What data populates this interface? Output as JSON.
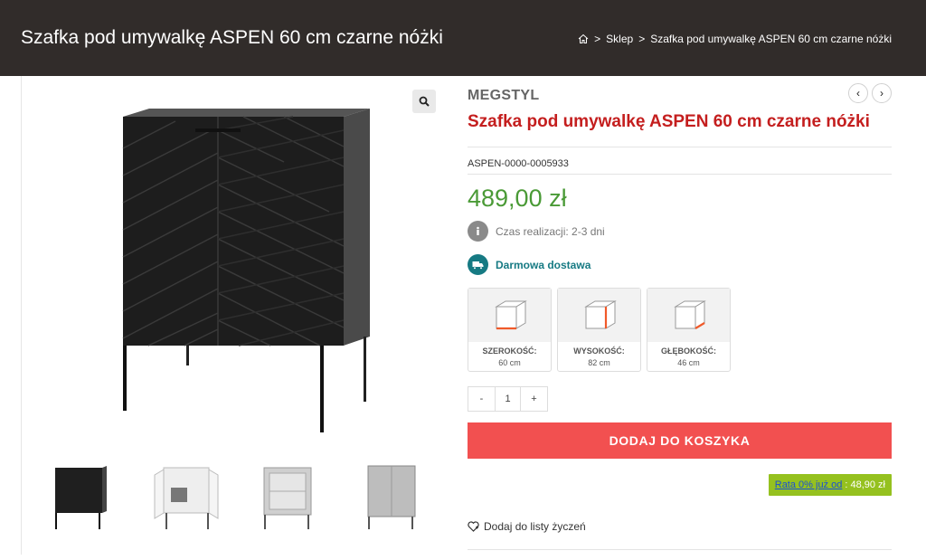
{
  "header": {
    "title": "Szafka pod umywalkę ASPEN 60 cm czarne nóżki",
    "breadcrumb": {
      "sep1": ">",
      "shop": "Sklep",
      "sep2": ">",
      "current": "Szafka pod umywalkę ASPEN 60 cm czarne nóżki"
    }
  },
  "gallery": {
    "zoom_icon": "search-icon",
    "thumbnails": [
      "front-black",
      "open-doors",
      "grey-open",
      "grey-front"
    ]
  },
  "product": {
    "brand": "MEGSTYL",
    "title": "Szafka pod umywalkę ASPEN 60 cm czarne nóżki",
    "sku": "ASPEN-0000-0005933",
    "price": "489,00 zł",
    "prev_arrow": "‹",
    "next_arrow": "›",
    "realization": "Czas realizacji: 2-3 dni",
    "delivery": "Darmowa dostawa",
    "dimensions": [
      {
        "label": "SZEROKOŚĆ:",
        "value": "60 cm",
        "icon": "width-box-icon"
      },
      {
        "label": "WYSOKOŚĆ:",
        "value": "82 cm",
        "icon": "height-box-icon"
      },
      {
        "label": "GŁĘBOKOŚĆ:",
        "value": "46 cm",
        "icon": "depth-box-icon"
      }
    ],
    "quantity": {
      "minus": "-",
      "value": "1",
      "plus": "+"
    },
    "add_to_cart": "DODAJ DO KOSZYKA",
    "installment": {
      "link": "Rata 0% już od",
      "amount": ": 48,90 zł"
    },
    "wishlist": "Dodaj do listy życzeń"
  },
  "colors": {
    "header_bg": "#312c2a",
    "title_red": "#c41e1e",
    "price_green": "#4a9a36",
    "cart_red": "#f25050",
    "delivery_teal": "#167a83",
    "rate_green": "#95c11f"
  }
}
